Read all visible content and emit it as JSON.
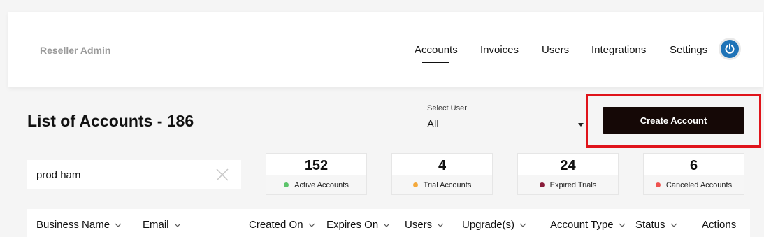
{
  "header": {
    "brand": "Reseller Admin",
    "nav": [
      {
        "label": "Accounts",
        "active": true
      },
      {
        "label": "Invoices",
        "active": false
      },
      {
        "label": "Users",
        "active": false
      },
      {
        "label": "Integrations",
        "active": false
      },
      {
        "label": "Settings",
        "active": false
      }
    ],
    "power_icon": "power-icon",
    "accent_color": "#1f73b7"
  },
  "page": {
    "title": "List of Accounts - 186"
  },
  "select_user": {
    "label": "Select User",
    "value": "All"
  },
  "create_button": {
    "label": "Create Account",
    "highlight_color": "#e0141b"
  },
  "search": {
    "value": "prod ham"
  },
  "stats": [
    {
      "value": "152",
      "label": "Active Accounts",
      "color": "#5cc46b"
    },
    {
      "value": "4",
      "label": "Trial Accounts",
      "color": "#f4a93c"
    },
    {
      "value": "24",
      "label": "Expired Trials",
      "color": "#8a1d3b"
    },
    {
      "value": "6",
      "label": "Canceled Accounts",
      "color": "#ef5350"
    }
  ],
  "table": {
    "columns": [
      {
        "label": "Business Name",
        "sortable": true
      },
      {
        "label": "Email",
        "sortable": true
      },
      {
        "label": "Created On",
        "sortable": true
      },
      {
        "label": "Expires On",
        "sortable": true
      },
      {
        "label": "Users",
        "sortable": true
      },
      {
        "label": "Upgrade(s)",
        "sortable": true
      },
      {
        "label": "Account Type",
        "sortable": true
      },
      {
        "label": "Status",
        "sortable": true
      },
      {
        "label": "Actions",
        "sortable": false
      }
    ]
  }
}
